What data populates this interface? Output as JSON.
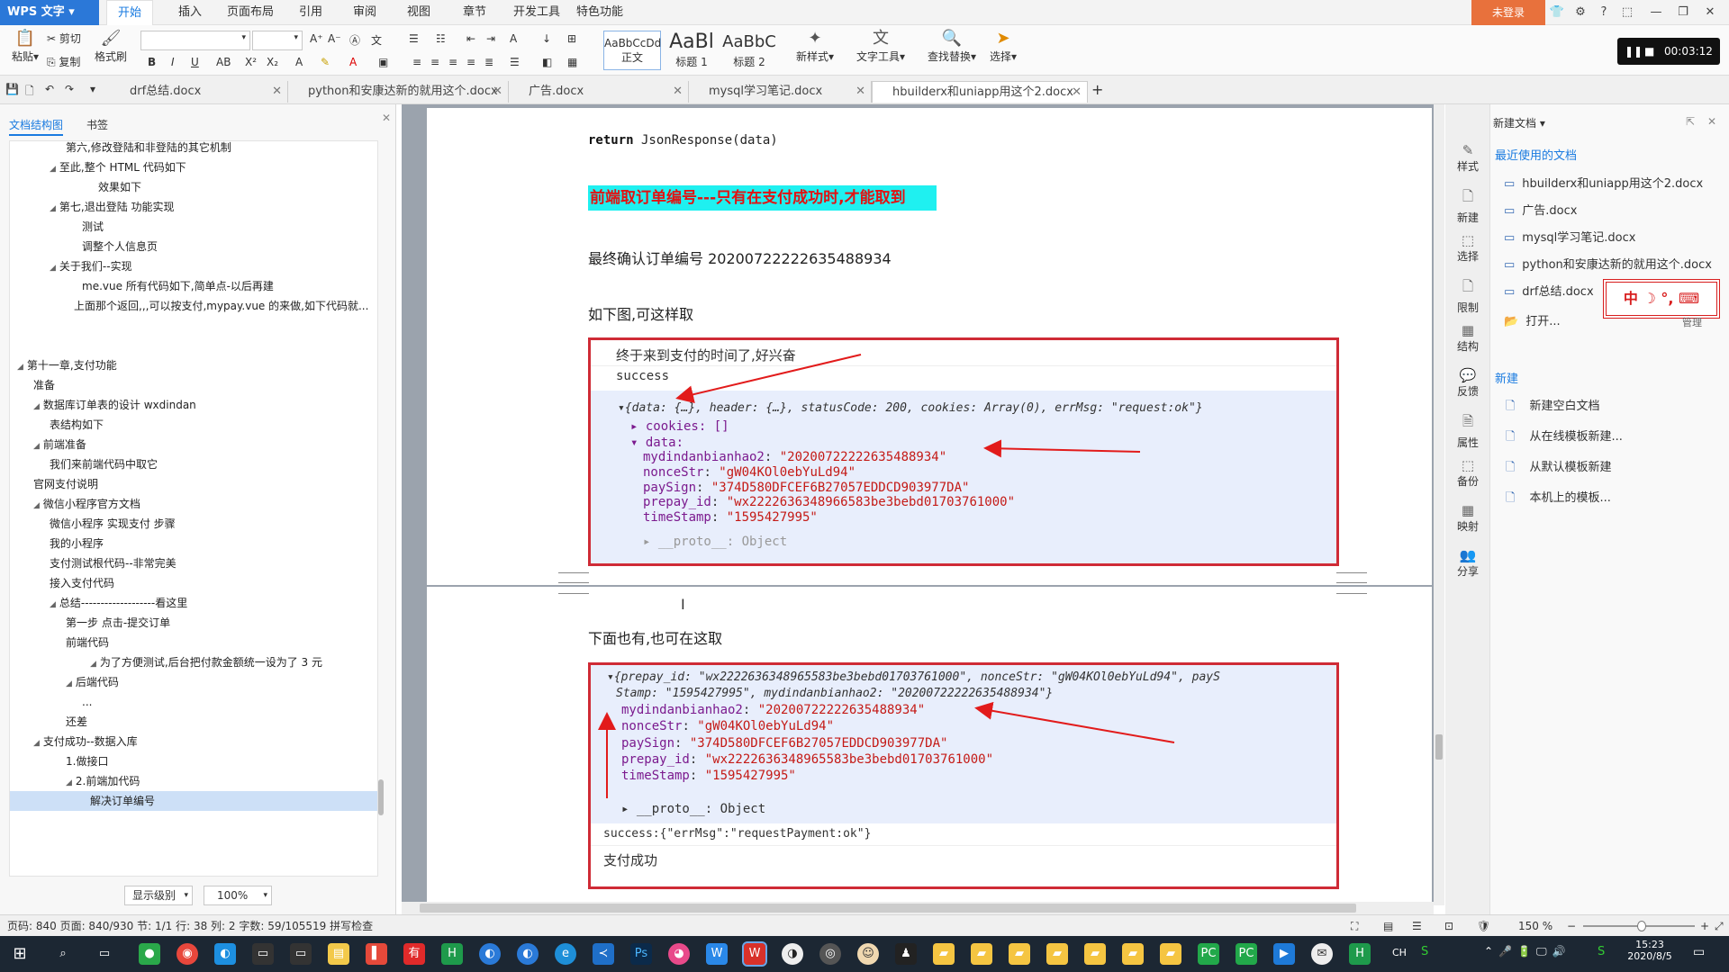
{
  "app": {
    "logo": "WPS 文字",
    "login": "未登录",
    "menu": [
      "开始",
      "插入",
      "页面布局",
      "引用",
      "审阅",
      "视图",
      "章节",
      "开发工具",
      "特色功能"
    ]
  },
  "timer": "00:03:12",
  "ribbon": {
    "paste": "粘贴",
    "cut": "剪切",
    "copy": "复制",
    "format_painter": "格式刷",
    "styles": [
      {
        "preview": "AaBbCcDd",
        "name": "正文"
      },
      {
        "preview": "AaBl",
        "name": "标题 1"
      },
      {
        "preview": "AaBbC",
        "name": "标题 2"
      }
    ],
    "new_style": "新样式",
    "text_tools": "文字工具",
    "find_replace": "查找替换",
    "select": "选择"
  },
  "tabs": [
    "drf总结.docx",
    "python和安康达新的就用这个.docx",
    "广告.docx",
    "mysql学习笔记.docx",
    "hbuilderx和uniapp用这个2.docx"
  ],
  "left_panel": {
    "tab_outline": "文档结构图",
    "tab_bookmark": "书签",
    "outline": [
      {
        "text": "第六,修改登陆和非登陆的其它机制",
        "level": 3,
        "arrow": false
      },
      {
        "text": "至此,整个 HTML 代码如下",
        "level": 2,
        "arrow": true
      },
      {
        "text": "效果如下",
        "level": 5,
        "arrow": false
      },
      {
        "text": "第七,退出登陆 功能实现",
        "level": 2,
        "arrow": true
      },
      {
        "text": "测试",
        "level": 4,
        "arrow": false
      },
      {
        "text": "调整个人信息页",
        "level": 4,
        "arrow": false
      },
      {
        "text": "关于我们--实现",
        "level": 2,
        "arrow": true
      },
      {
        "text": "me.vue 所有代码如下,简单点-以后再建",
        "level": 4,
        "arrow": false
      },
      {
        "text": "上面那个返回,,,可以按支付,mypay.vue 的来做,如下代码就...",
        "level": 3.5,
        "arrow": false
      },
      {
        "text": "",
        "level": 0,
        "arrow": false
      },
      {
        "text": "",
        "level": 0,
        "arrow": false
      },
      {
        "text": "第十一章,支付功能",
        "level": 0,
        "arrow": true
      },
      {
        "text": "准备",
        "level": 1,
        "arrow": false
      },
      {
        "text": "数据库订单表的设计 wxdindan",
        "level": 1,
        "arrow": true
      },
      {
        "text": "表结构如下",
        "level": 2,
        "arrow": false
      },
      {
        "text": "前端准备",
        "level": 1,
        "arrow": true
      },
      {
        "text": "我们来前端代码中取它",
        "level": 2,
        "arrow": false
      },
      {
        "text": "官网支付说明",
        "level": 1,
        "arrow": false
      },
      {
        "text": "微信小程序官方文档",
        "level": 1,
        "arrow": true
      },
      {
        "text": "微信小程序 实现支付 步骤",
        "level": 2,
        "arrow": false
      },
      {
        "text": "我的小程序",
        "level": 2,
        "arrow": false
      },
      {
        "text": "支付测试根代码--非常完美",
        "level": 2,
        "arrow": false
      },
      {
        "text": "接入支付代码",
        "level": 2,
        "arrow": false
      },
      {
        "text": "总结-------------------看这里",
        "level": 2,
        "arrow": true
      },
      {
        "text": "第一步 点击-提交订单",
        "level": 3,
        "arrow": false
      },
      {
        "text": "前端代码",
        "level": 3,
        "arrow": false
      },
      {
        "text": "为了方便测试,后台把付款金额统一设为了 3 元",
        "level": 4.5,
        "arrow": true
      },
      {
        "text": "后端代码",
        "level": 3,
        "arrow": true
      },
      {
        "text": "...",
        "level": 4,
        "arrow": false
      },
      {
        "text": "还差",
        "level": 3,
        "arrow": false
      },
      {
        "text": "支付成功--数据入库",
        "level": 1,
        "arrow": true
      },
      {
        "text": "1.做接口",
        "level": 3,
        "arrow": false
      },
      {
        "text": "2.前端加代码",
        "level": 3,
        "arrow": true
      },
      {
        "text": "解决订单编号",
        "level": 4.5,
        "arrow": false,
        "selected": true
      }
    ],
    "display_level": "显示级别",
    "zoom": "100%"
  },
  "doc": {
    "code_kw": "return",
    "code_rest": " JsonResponse(data)",
    "highlight": "前端取订单编号---只有在支付成功时,才能取到",
    "final_order": "最终确认订单编号 20200722222635488934",
    "see_below": "如下图,可这样取",
    "shot1": {
      "line1": "终于来到支付的时间了,好兴奋",
      "line2": "success",
      "obj_summary": "▾{data: {…}, header: {…}, statusCode: 200, cookies: Array(0), errMsg: \"request:ok\"}",
      "cookies": "▸ cookies: []",
      "data": "▾ data:",
      "fields": [
        {
          "k": "mydindanbianhao2",
          "v": "\"20200722222635488934\""
        },
        {
          "k": "nonceStr",
          "v": "\"gW04KOl0ebYuLd94\""
        },
        {
          "k": "paySign",
          "v": "\"374D580DFCEF6B27057EDDCD903977DA\""
        },
        {
          "k": "prepay_id",
          "v": "\"wx2222636348966583be3bebd01703761000\""
        },
        {
          "k": "timeStamp",
          "v": "\"1595427995\""
        }
      ],
      "proto": "▸ __proto__: Object"
    },
    "below_text": "下面也有,也可在这取",
    "shot2": {
      "obj_line1": "▾{prepay_id: \"wx2222636348965583be3bebd01703761000\", nonceStr: \"gW04KOl0ebYuLd94\", payS",
      "obj_line2": "Stamp: \"1595427995\", mydindanbianhao2: \"20200722222635488934\"}",
      "fields": [
        {
          "k": "mydindanbianhao2",
          "v": "\"20200722222635488934\""
        },
        {
          "k": "nonceStr",
          "v": "\"gW04KOl0ebYuLd94\""
        },
        {
          "k": "paySign",
          "v": "\"374D580DFCEF6B27057EDDCD903977DA\""
        },
        {
          "k": "prepay_id",
          "v": "\"wx2222636348965583be3bebd01703761000\""
        },
        {
          "k": "timeStamp",
          "v": "\"1595427995\""
        }
      ],
      "proto": "▸ __proto__: Object",
      "success_line": "success:{\"errMsg\":\"requestPayment:ok\"}",
      "paid": "支付成功"
    }
  },
  "right_panel": {
    "header": "新建文档",
    "recent_title": "最近使用的文档",
    "recent": [
      "hbuilderx和uniapp用这个2.docx",
      "广告.docx",
      "mysql学习笔记.docx",
      "python和安康达新的就用这个.docx",
      "drf总结.docx"
    ],
    "open": "打开...",
    "new_title": "新建",
    "new_items": [
      "新建空白文档",
      "从在线模板新建...",
      "从默认模板新建",
      "本机上的模板..."
    ],
    "side_buttons": [
      "样式",
      "新建",
      "选择",
      "限制",
      "结构",
      "反馈",
      "属性",
      "备份",
      "映射",
      "分享"
    ],
    "ime": "中 ☽ °, ⌨",
    "manage": "管理"
  },
  "status": {
    "text": "页码: 840  页面: 840/930  节: 1/1  行: 38  列: 2  字数: 59/105519  拼写检查",
    "zoom": "150 %"
  },
  "taskbar": {
    "time": "15:23",
    "date": "2020/8/5",
    "ime": "CH"
  }
}
